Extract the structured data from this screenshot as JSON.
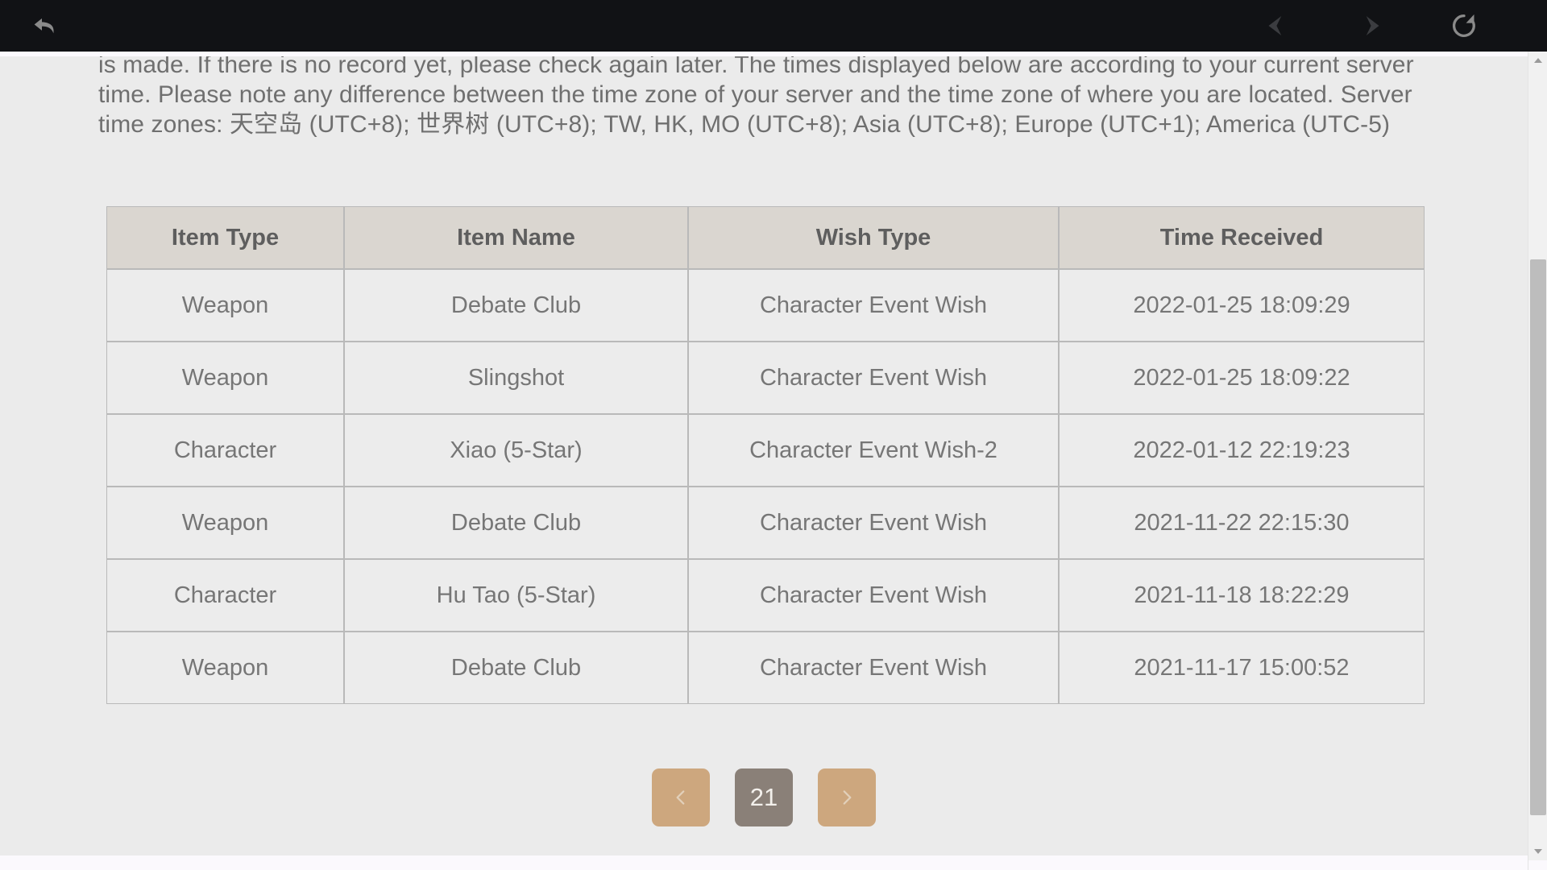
{
  "browser": {
    "back_icon": "undo-arrow-icon",
    "nav_back_icon": "chevron-left-icon",
    "nav_forward_icon": "chevron-right-icon",
    "reload_icon": "refresh-icon"
  },
  "content": {
    "intro_line1": "is made. If there is no record yet, please check again later. The times displayed below are according to your current",
    "intro_line2": "server time. Please note any difference between the time zone of your server and the time zone of where you are",
    "intro_line3_a": "located. Server time zones: ",
    "intro_cjk_1": "天空岛",
    "intro_line3_b": " (UTC+8); ",
    "intro_cjk_2": "世界树",
    "intro_line3_c": " (UTC+8); TW, HK, MO (UTC+8); Asia (UTC+8); Europe",
    "intro_line4": "(UTC+1); America (UTC-5)"
  },
  "table": {
    "headers": [
      "Item Type",
      "Item Name",
      "Wish Type",
      "Time Received"
    ],
    "rows": [
      {
        "item_type": "Weapon",
        "item_name": "Debate Club",
        "rarity": "normal",
        "wish_type": "Character Event Wish",
        "time_received": "2022-01-25 18:09:29"
      },
      {
        "item_type": "Weapon",
        "item_name": "Slingshot",
        "rarity": "normal",
        "wish_type": "Character Event Wish",
        "time_received": "2022-01-25 18:09:22"
      },
      {
        "item_type": "Character",
        "item_name": "Xiao (5-Star)",
        "rarity": "five-star",
        "wish_type": "Character Event Wish-2",
        "time_received": "2022-01-12 22:19:23"
      },
      {
        "item_type": "Weapon",
        "item_name": "Debate Club",
        "rarity": "normal",
        "wish_type": "Character Event Wish",
        "time_received": "2021-11-22 22:15:30"
      },
      {
        "item_type": "Character",
        "item_name": "Hu Tao (5-Star)",
        "rarity": "five-star",
        "wish_type": "Character Event Wish",
        "time_received": "2021-11-18 18:22:29"
      },
      {
        "item_type": "Weapon",
        "item_name": "Debate Club",
        "rarity": "normal",
        "wish_type": "Character Event Wish",
        "time_received": "2021-11-17 15:00:52"
      }
    ]
  },
  "pagination": {
    "prev_icon": "chevron-left-icon",
    "current_page": "21",
    "next_icon": "chevron-right-icon"
  },
  "colors": {
    "five_star": "#bf6b30",
    "pager_arrow_bg": "#cda77e",
    "pager_current_bg": "#8a8078",
    "table_header_bg": "#dad6d0",
    "table_cell_bg": "#ececec",
    "page_bg": "#ebebeb",
    "chrome_bg": "#111215"
  }
}
